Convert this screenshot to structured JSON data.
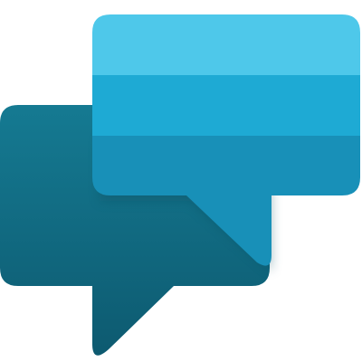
{
  "icon": {
    "name": "chat-bubbles-icon",
    "colors": {
      "back_bubble_top": "#157a92",
      "back_bubble_bottom": "#0d5a70",
      "front_band_top": "#4ec8ea",
      "front_band_middle": "#1eaad4",
      "front_band_bottom": "#1890b8",
      "shadow": "#0a4a5c"
    }
  }
}
